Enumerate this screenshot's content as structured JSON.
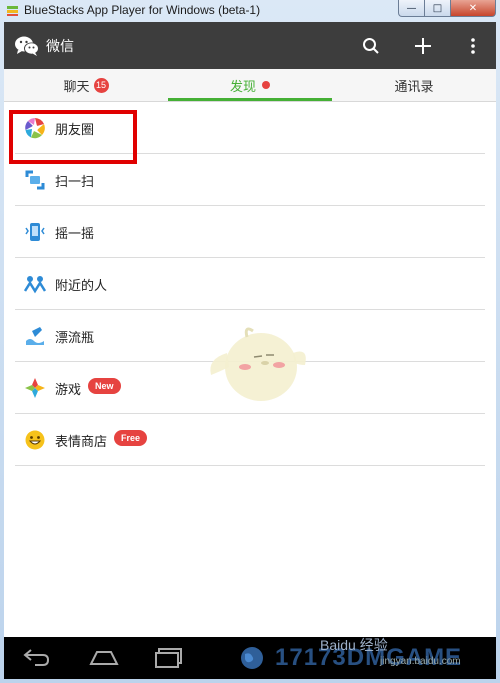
{
  "window": {
    "title": "BlueStacks App Player for Windows (beta-1)",
    "minimize_icon": "minimize-icon",
    "maximize_icon": "maximize-icon",
    "close_icon": "close-icon"
  },
  "appbar": {
    "title": "微信",
    "icons": [
      "wechat-logo-icon",
      "search-icon",
      "plus-icon",
      "more-vertical-icon"
    ]
  },
  "tabs": [
    {
      "label": "聊天",
      "badge": "15"
    },
    {
      "label": "发现",
      "dot": true,
      "selected": true
    },
    {
      "label": "通讯录"
    }
  ],
  "list": [
    {
      "label": "朋友圈",
      "icon": "moments-icon"
    },
    {
      "label": "扫一扫",
      "icon": "scan-icon"
    },
    {
      "label": "摇一摇",
      "icon": "shake-icon"
    },
    {
      "label": "附近的人",
      "icon": "people-nearby-icon"
    },
    {
      "label": "漂流瓶",
      "icon": "drift-bottle-icon"
    },
    {
      "label": "游戏",
      "icon": "games-icon",
      "tag": "New"
    },
    {
      "label": "表情商店",
      "icon": "sticker-shop-icon",
      "tag": "Free"
    }
  ],
  "navbar": {
    "icons": [
      "back-icon",
      "home-icon",
      "recent-apps-icon",
      "globe-icon"
    ]
  },
  "watermark": {
    "baidu": "Baidu 经验",
    "url": "jingyan.baidu.com",
    "logo": "17173DMGAME"
  },
  "colors": {
    "accent_green": "#45b035",
    "badge_red": "#e64340",
    "appbar_bg": "#3d3d3d",
    "highlight_red": "#e00000"
  }
}
